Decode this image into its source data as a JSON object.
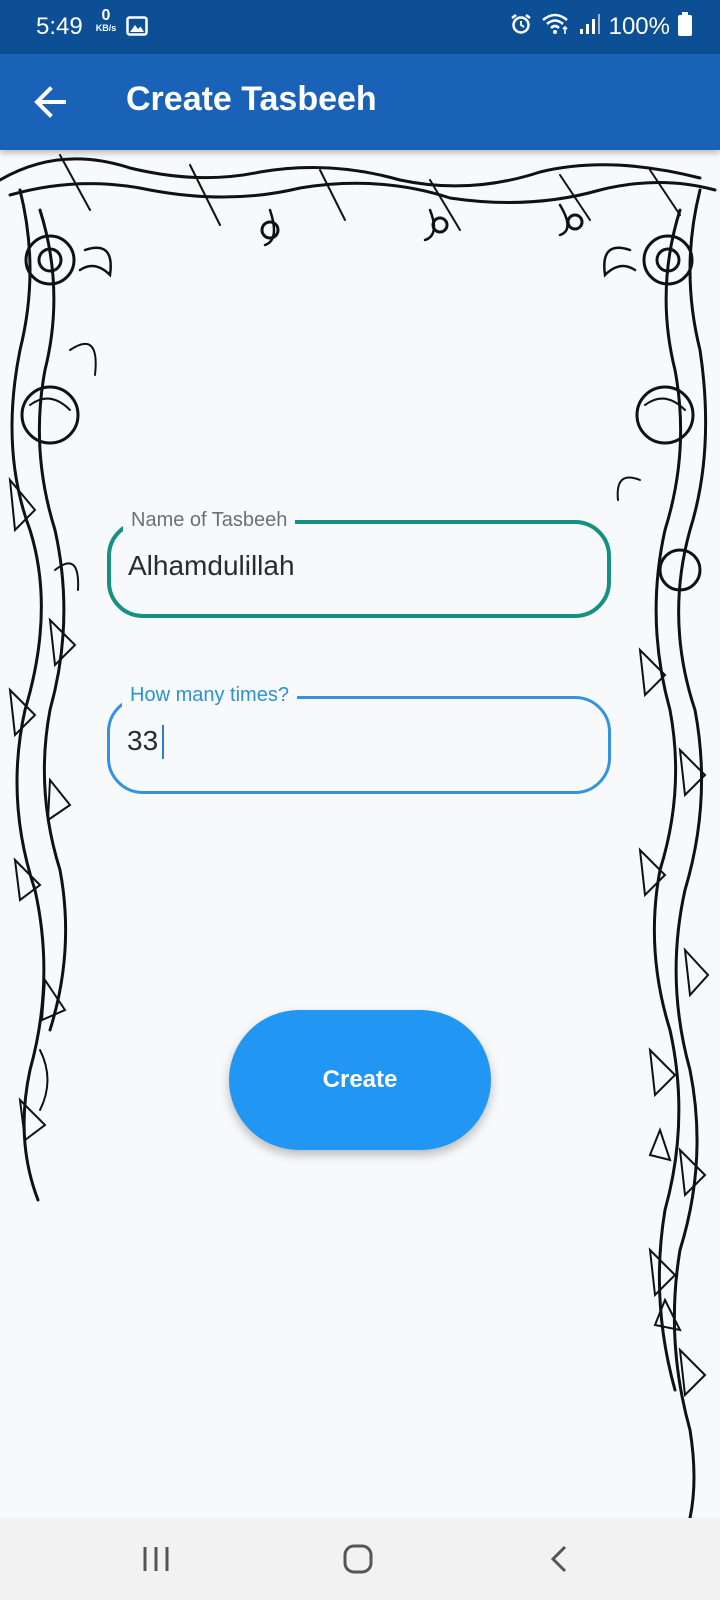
{
  "status_bar": {
    "time": "5:49",
    "net_speed_value": "0",
    "net_speed_unit": "KB/s",
    "battery": "100%",
    "icons": [
      "image-icon",
      "alarm-icon",
      "wifi-icon",
      "signal-icon",
      "battery-icon"
    ]
  },
  "app_bar": {
    "title": "Create Tasbeeh",
    "back_icon": "arrow-left-icon",
    "color": "#1a62b8"
  },
  "form": {
    "name_field": {
      "label": "Name of Tasbeeh",
      "value": "Alhamdulillah",
      "border_color": "#159083"
    },
    "times_field": {
      "label": "How many times?",
      "value": "33",
      "border_color": "#3294e0",
      "focused": true
    },
    "create_button": {
      "label": "Create",
      "color": "#2196f3"
    }
  },
  "nav_bar": {
    "icons": [
      "recent-apps-icon",
      "home-icon",
      "back-icon"
    ]
  }
}
